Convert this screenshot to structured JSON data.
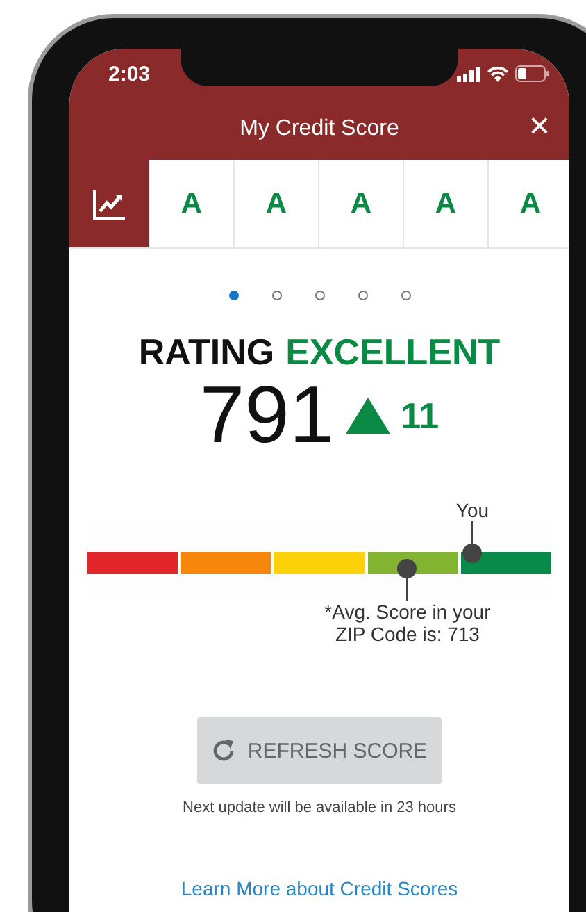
{
  "status_bar": {
    "time": "2:03"
  },
  "header": {
    "title": "My Credit Score",
    "close": "×"
  },
  "tabs": [
    {
      "kind": "chart",
      "selected": true
    },
    {
      "kind": "grade",
      "label": "A",
      "selected": false
    },
    {
      "kind": "grade",
      "label": "A",
      "selected": false
    },
    {
      "kind": "grade",
      "label": "A",
      "selected": false
    },
    {
      "kind": "grade",
      "label": "A",
      "selected": false
    },
    {
      "kind": "grade",
      "label": "A",
      "selected": false
    }
  ],
  "pager": [
    {
      "selected": true
    },
    {
      "selected": false
    },
    {
      "selected": false
    },
    {
      "selected": false
    },
    {
      "selected": false
    }
  ],
  "rating": {
    "label": "RATING",
    "value": "EXCELLENT"
  },
  "score": {
    "value": "791",
    "change": "11"
  },
  "gauge": {
    "segments": [
      {
        "color": "#e3262b"
      },
      {
        "color": "#f7860d"
      },
      {
        "color": "#fdd20a"
      },
      {
        "color": "#82b431"
      },
      {
        "color": "#078a4a"
      }
    ],
    "you": {
      "label": "You",
      "level": 0.83
    },
    "average": {
      "label": "*Avg. Score in your ZIP Code is: 713",
      "level": 0.69
    }
  },
  "refresh": {
    "label": "REFRESH SCORE",
    "note": "Next update will be available in 23 hours"
  },
  "link": "Learn More about Credit Scores"
}
